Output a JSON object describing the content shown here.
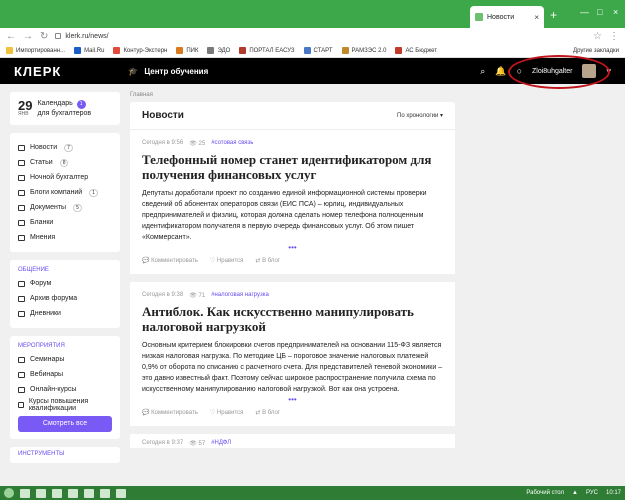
{
  "browser": {
    "tab_title": "Новости",
    "tab_close": "×",
    "new_tab": "+",
    "url": "klerk.ru/news/",
    "window_controls": [
      "—",
      "□",
      "×"
    ]
  },
  "bookmarks": [
    {
      "label": "Импортированн...",
      "color": "#f0c23b"
    },
    {
      "label": "Mail.Ru",
      "color": "#1a5dc8"
    },
    {
      "label": "Контур-Экстерн",
      "color": "#e24a3b"
    },
    {
      "label": "ПИК",
      "color": "#d97a1e"
    },
    {
      "label": "ЭДО",
      "color": "#7a7a7a"
    },
    {
      "label": "ПОРТАЛ ЕАСУЗ",
      "color": "#b33a2a"
    },
    {
      "label": "СТАРТ",
      "color": "#4a78c8"
    },
    {
      "label": "РАМЗЭС 2.0",
      "color": "#c08a2a"
    },
    {
      "label": "АС Бюджет",
      "color": "#c43a2a"
    }
  ],
  "bookmarks_other": "Другие закладки",
  "header": {
    "logo": "КЛЕРК",
    "center_title": "Центр обучения",
    "username": "Zloi8uhgalter",
    "dropdown": "▾"
  },
  "sidebar": {
    "calendar": {
      "day": "29",
      "month": "ЯНВ",
      "label_line1": "Календарь",
      "label_line2": "для бухгалтеров",
      "badge": "1"
    },
    "menu": [
      {
        "label": "Новости",
        "badge": "7",
        "badge_style": "white"
      },
      {
        "label": "Статьи",
        "badge": "8",
        "badge_style": "white"
      },
      {
        "label": "Ночной бухгалтер",
        "badge": ""
      },
      {
        "label": "Блоги компаний",
        "badge": "1",
        "badge_style": "white"
      },
      {
        "label": "Документы",
        "badge": "5",
        "badge_style": "white"
      },
      {
        "label": "Бланки",
        "badge": ""
      },
      {
        "label": "Мнения",
        "badge": ""
      }
    ],
    "communication_title": "ОБЩЕНИЕ",
    "communication": [
      "Форум",
      "Архив форума",
      "Дневники"
    ],
    "events_title": "МЕРОПРИЯТИЯ",
    "events": [
      "Семинары",
      "Вебинары",
      "Онлайн-курсы",
      "Курсы повышения квалификации"
    ],
    "see_all": "Смотреть все",
    "tools_title": "ИНСТРУМЕНТЫ"
  },
  "content": {
    "breadcrumb": "Главная",
    "feed_title": "Новости",
    "sort_label": "По хронологии",
    "articles": [
      {
        "time": "Сегодня в 9:56",
        "views": "25",
        "tag": "#сотовая связь",
        "title": "Телефонный номер станет идентификатором для получения финансовых услуг",
        "body": "Депутаты доработали проект по созданию единой информационной системы проверки сведений об абонентах операторов связи (ЕИС ПСА) – юрлиц, индивидуальных предпринимателей и физлиц, которая должна сделать номер телефона полноценным идентификатором получателя в первую очередь финансовых услуг. Об этом пишет «Коммерсант».",
        "comment": "Комментировать",
        "like": "Нравится",
        "blog": "В блог"
      },
      {
        "time": "Сегодня в 9:38",
        "views": "71",
        "tag": "#налоговая нагрузка",
        "title": "Антиблок. Как искусственно манипулировать налоговой нагрузкой",
        "body": "Основным критерием блокировки счетов предпринимателей на основании 115-ФЗ является низкая налоговая нагрузка. По методике ЦБ – пороговое значение налоговых платежей 0,9% от оборота по списанию с расчетного счета. Для представителей теневой экономики – это давно известный факт. Поэтому сейчас широкое распространение получила схема по искусственному манипулированию налоговой нагрузкой. Вот как она устроена.",
        "comment": "Комментировать",
        "like": "Нравится",
        "blog": "В блог"
      },
      {
        "time": "Сегодня в 9:37",
        "views": "57",
        "tag": "#НДФЛ"
      }
    ]
  },
  "taskbar": {
    "desktop_label": "Рабочий стол",
    "lang": "РУС",
    "time": "10:17"
  }
}
